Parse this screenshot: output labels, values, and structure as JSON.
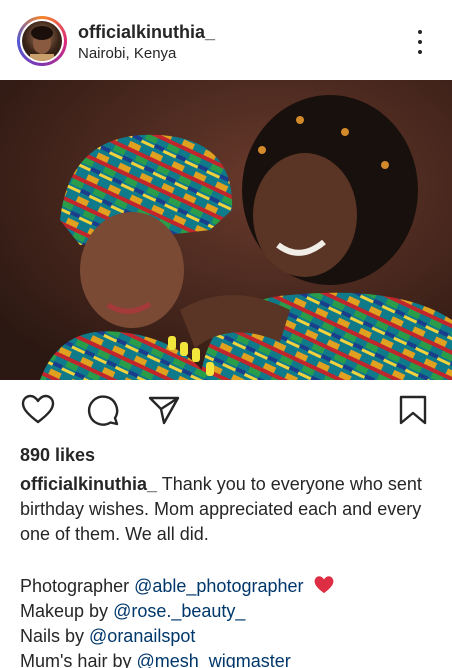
{
  "post": {
    "username": "officialkinuthia_",
    "location": "Nairobi, Kenya"
  },
  "icons": {
    "more": "more-vertical-icon",
    "like": "heart-icon",
    "comment": "comment-icon",
    "share": "send-icon",
    "save": "bookmark-icon",
    "credit": "red-heart-emoji"
  },
  "likes": "890 likes",
  "caption": {
    "username": "officialkinuthia_",
    "text": " Thank you to everyone who sent birthday wishes. Mom appreciated each and every one of them. We all did."
  },
  "credits": [
    {
      "label": "Photographer ",
      "mention": "@able_photographer"
    },
    {
      "label": "Makeup by ",
      "mention": "@rose._beauty_"
    },
    {
      "label": "Nails by ",
      "mention": "@oranailspot"
    },
    {
      "label": "Mum's hair by ",
      "mention": "@mesh_wigmaster"
    }
  ],
  "colors": {
    "text": "#262626",
    "mention": "#00376b",
    "heart": "#e0245e"
  }
}
